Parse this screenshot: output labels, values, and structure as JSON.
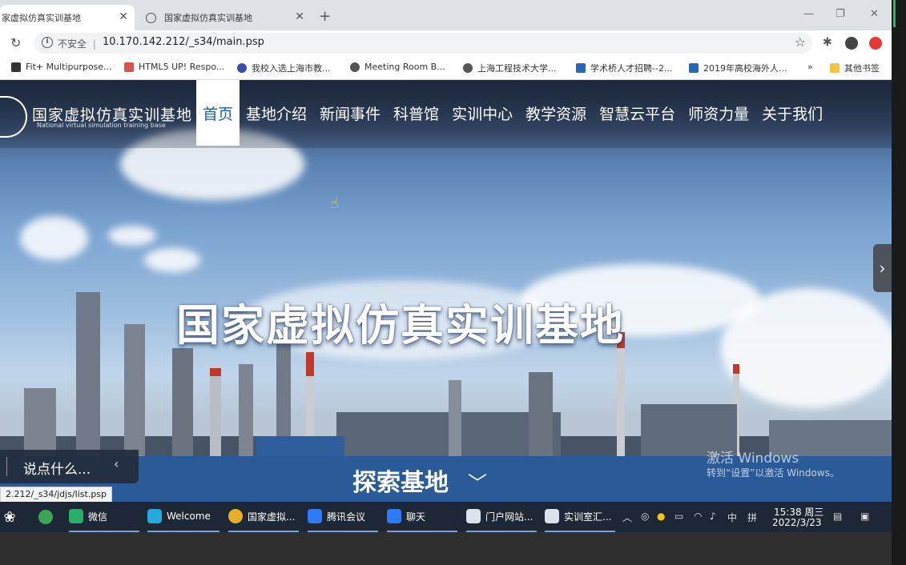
{
  "browser": {
    "tabs": [
      {
        "title": "家虚拟仿真实训基地",
        "active": true
      },
      {
        "title": "国家虚拟仿真实训基地",
        "active": false
      }
    ],
    "new_tab": "+",
    "window_controls": {
      "minimize": "—",
      "restore": "❐",
      "close": "✕"
    },
    "address": {
      "security": "不安全",
      "separator": "|",
      "url": "10.170.142.212/_s34/main.psp"
    },
    "bookmarks": [
      {
        "label": "Fit+ Multipurpose...",
        "color": "#333333"
      },
      {
        "label": "HTML5 UP! Respo...",
        "color": "#d9534f"
      },
      {
        "label": "我校入选上海市教...",
        "color": "#3a4fa8"
      },
      {
        "label": "Meeting Room B...",
        "color": "#555555"
      },
      {
        "label": "上海工程技术大学...",
        "color": "#555555"
      },
      {
        "label": "学术桥人才招聘--2...",
        "color": "#2a66b8"
      },
      {
        "label": "2019年高校海外人...",
        "color": "#2a66b8"
      }
    ],
    "more_bookmarks": "»",
    "other_bookmarks": "其他书签"
  },
  "site": {
    "name": "国家虚拟仿真实训基地",
    "subtitle": "National virtual simulation training base",
    "nav": [
      "首页",
      "基地介绍",
      "新闻事件",
      "科普馆",
      "实训中心",
      "教学资源",
      "智慧云平台",
      "师资力量",
      "关于我们"
    ],
    "active_nav": 0,
    "hero_title": "国家虚拟仿真实训基地",
    "explore": "探索基地",
    "chat_placeholder": "说点什么...",
    "status_url": "2.212/_s34/jdjs/list.psp"
  },
  "os": {
    "watermark_line1": "激活 Windows",
    "watermark_line2": "转到“设置”以激活 Windows。",
    "taskbar": [
      {
        "label": "微信",
        "color": "#2aae67"
      },
      {
        "label": "Welcome",
        "color": "#26a8d8"
      },
      {
        "label": "国家虚拟...",
        "color": "#e8b125"
      },
      {
        "label": "腾讯会议",
        "color": "#2f7bf6"
      },
      {
        "label": "聊天",
        "color": "#2f7bf6"
      },
      {
        "label": "门户网站...",
        "color": "#d8e3ee"
      },
      {
        "label": "实训室汇...",
        "color": "#d8e3ee"
      }
    ],
    "ime": "中",
    "ime2": "拼",
    "time": "15:38 周三",
    "date": "2022/3/23"
  }
}
